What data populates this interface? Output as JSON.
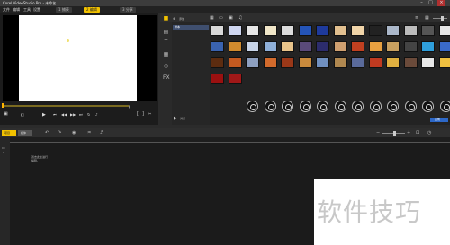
{
  "app": {
    "title": "Corel VideoStudio Pro - 未命名"
  },
  "menu": [
    "文件",
    "编辑",
    "工具",
    "设置"
  ],
  "steps": [
    {
      "label": "1 捕获",
      "active": false
    },
    {
      "label": "2 编辑",
      "active": true
    },
    {
      "label": "3 分享",
      "active": false
    }
  ],
  "library": {
    "folder_label": "添加",
    "tree_item": "样本",
    "done": "完成",
    "browse": "浏览"
  },
  "timeline": {
    "tab1": "项目",
    "tab2": "媒体",
    "clip_text": "双击此处进行编辑。"
  },
  "thumb_colors": [
    [
      "#d9d9d9",
      "#cfd6f0",
      "#e6e6e6",
      "#f0e6c8",
      "#dcdcdc",
      "#2454b8",
      "#1e3a9c",
      "#e2c090",
      "#f0d4a8",
      "#222222",
      "#aab7c9",
      "#bbbbbb",
      "#555555",
      "#e6e6e6"
    ],
    [
      "#3a63b0",
      "#d18b2e",
      "#c9d5e8",
      "#8fb0d9",
      "#e9c48a",
      "#5a4a7a",
      "#2c2c6c",
      "#cfa070",
      "#c04020",
      "#e8a040",
      "#c8a060",
      "#444444",
      "#2f9fdc",
      "#3a6ac8"
    ],
    [
      "#5c2c10",
      "#c45a20",
      "#8ea0c0",
      "#d26a2c",
      "#9a3818",
      "#c98a3c",
      "#7090c0",
      "#b08850",
      "#5a6a9a",
      "#c03a20",
      "#e0b040",
      "#6a4a3a",
      "#e8e8e8",
      "#f0c040"
    ],
    [
      "#9a1010",
      "#a01818"
    ]
  ],
  "watermark": "软件技巧"
}
